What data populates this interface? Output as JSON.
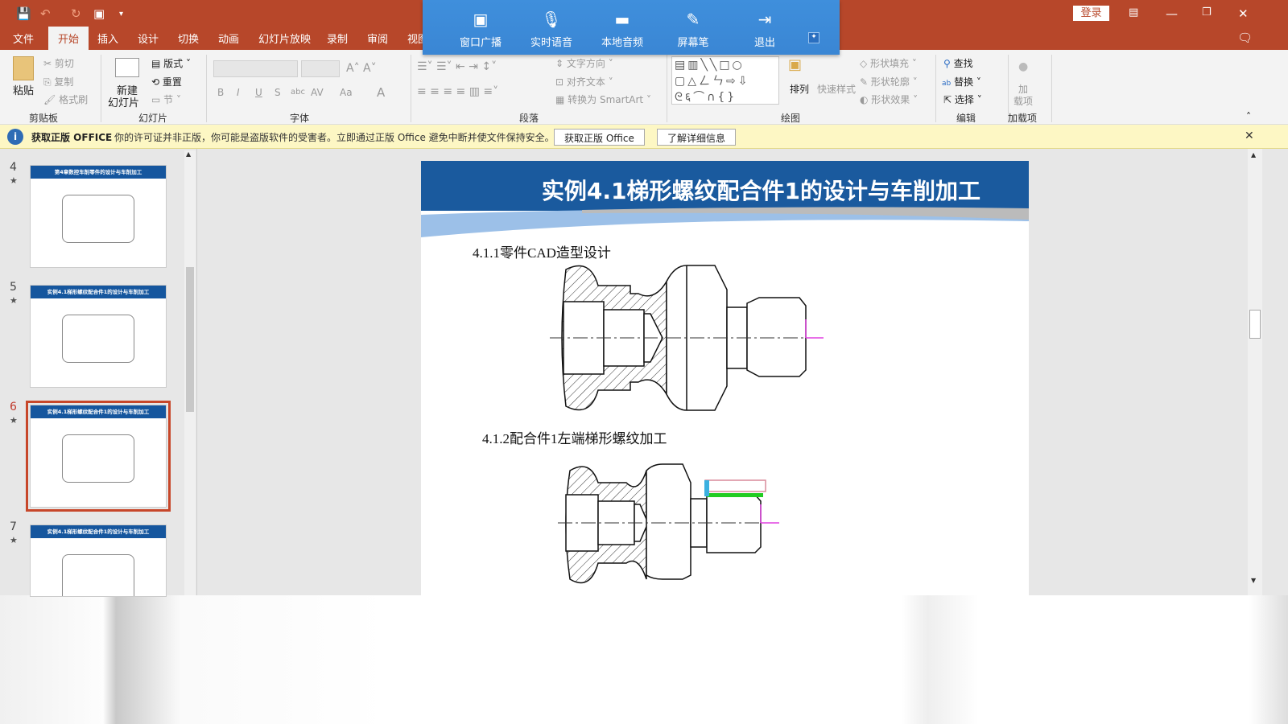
{
  "quick_access": {
    "icons": [
      "save-icon",
      "undo-icon",
      "redo-icon",
      "presentation-icon",
      "customize-icon"
    ]
  },
  "window": {
    "login": "登录"
  },
  "tabs": [
    "文件",
    "开始",
    "插入",
    "设计",
    "切换",
    "动画",
    "幻灯片放映",
    "录制",
    "审阅",
    "视图"
  ],
  "active_tab": "开始",
  "broadcast": {
    "items": [
      "窗口广播",
      "实时语音",
      "本地音频",
      "屏幕笔",
      "退出"
    ]
  },
  "ribbon": {
    "clipboard": {
      "paste": "粘贴",
      "cut": "剪切",
      "copy": "复制",
      "format_painter": "格式刷",
      "group": "剪贴板"
    },
    "slides": {
      "new_slide_1": "新建",
      "new_slide_2": "幻灯片",
      "layout": "版式",
      "reset": "重置",
      "section": "节",
      "group": "幻灯片"
    },
    "font": {
      "group": "字体",
      "bold": "B",
      "italic": "I",
      "underline": "U",
      "shadow": "S",
      "strike": "abc",
      "spacing": "AV",
      "case": "Aa",
      "color": "A"
    },
    "paragraph": {
      "text_direction": "文字方向",
      "align_text": "对齐文本",
      "smartart": "转换为 SmartArt",
      "group": "段落"
    },
    "drawing": {
      "arrange": "排列",
      "quick_styles": "快速样式",
      "fill": "形状填充",
      "outline": "形状轮廓",
      "effects": "形状效果",
      "group": "绘图"
    },
    "editing": {
      "find": "查找",
      "replace": "替换",
      "select": "选择",
      "group": "编辑"
    },
    "addins": {
      "label1": "加",
      "label2": "载项",
      "group": "加载项"
    }
  },
  "notice": {
    "title": "获取正版 OFFICE",
    "message": "你的许可证并非正版，你可能是盗版软件的受害者。立即通过正版 Office 避免中断并使文件保持安全。",
    "btn_get": "获取正版 Office",
    "btn_learn": "了解详细信息"
  },
  "thumbnails": [
    {
      "num": "4",
      "title": "第4章数控车削零件的设计与车削加工",
      "selected": false
    },
    {
      "num": "5",
      "title": "实例4.1梯形螺纹配合件1的设计与车削加工",
      "selected": false
    },
    {
      "num": "6",
      "title": "实例4.1梯形螺纹配合件1的设计与车削加工",
      "selected": true
    },
    {
      "num": "7",
      "title": "实例4.1梯形螺纹配合件1的设计与车削加工",
      "selected": false
    }
  ],
  "slide": {
    "title": "实例4.1梯形螺纹配合件1的设计与车削加工",
    "section1": "4.1.1零件CAD造型设计",
    "section2": "4.1.2配合件1左端梯形螺纹加工"
  },
  "colors": {
    "accent": "#b7472a",
    "slide_header": "#1a5a9e",
    "broadcast_bar": "#3b8ad8"
  }
}
